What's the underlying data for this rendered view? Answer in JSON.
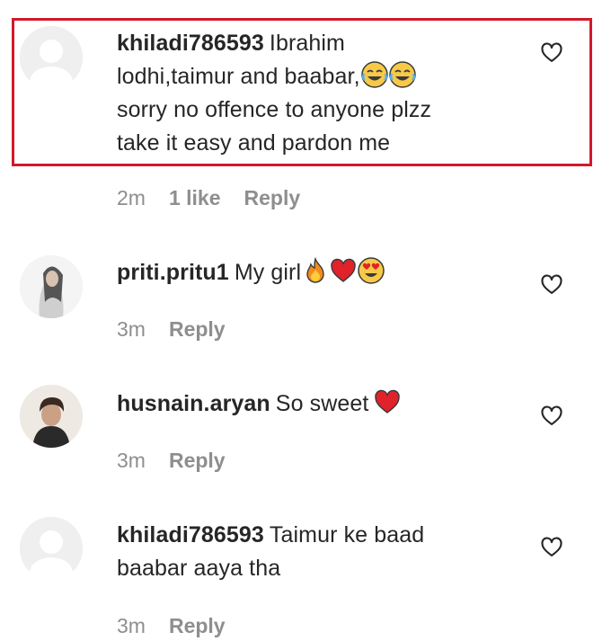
{
  "highlight_color": "#d11a2a",
  "comments": [
    {
      "avatar": "default-avatar",
      "username": "khiladi786593",
      "text_line1": "Ibrahim",
      "text_line2": "lodhi,taimur and baabar,",
      "text_line3": "sorry no offence to anyone plzz",
      "text_line4": "take it easy and pardon me",
      "emojis": [
        "face-with-tears-of-joy",
        "face-with-tears-of-joy"
      ],
      "time": "2m",
      "likes": "1 like",
      "reply": "Reply",
      "like_icon": "heart-outline-icon"
    },
    {
      "avatar": "photo-avatar",
      "username": "priti.pritu1",
      "text": "My girl",
      "emojis": [
        "fire",
        "red-heart",
        "heart-eyes-face"
      ],
      "time": "3m",
      "reply": "Reply",
      "like_icon": "heart-outline-icon"
    },
    {
      "avatar": "photo-avatar",
      "username": "husnain.aryan",
      "text": "So sweet",
      "emojis": [
        "red-heart"
      ],
      "time": "3m",
      "reply": "Reply",
      "like_icon": "heart-outline-icon"
    },
    {
      "avatar": "default-avatar",
      "username": "khiladi786593",
      "text_line1": "Taimur ke baad",
      "text_line2": "baabar aaya tha",
      "time": "3m",
      "reply": "Reply",
      "like_icon": "heart-outline-icon"
    }
  ]
}
